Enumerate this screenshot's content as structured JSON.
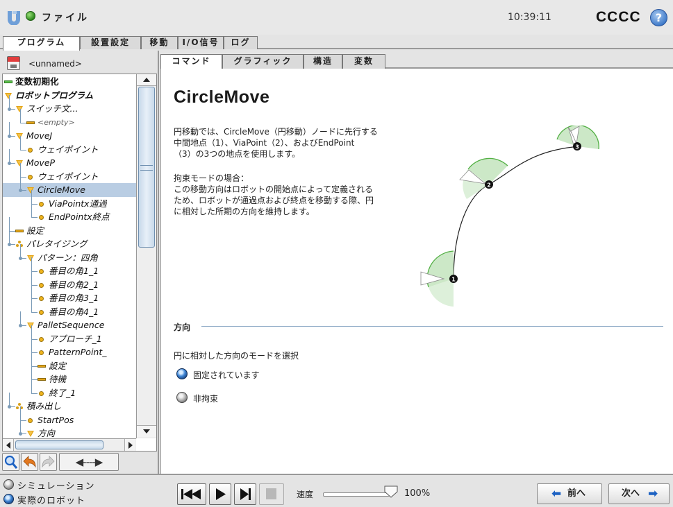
{
  "header": {
    "app_title": "ファイル",
    "clock": "10:39:11",
    "robot_name": "CCCC",
    "help_icon": "?"
  },
  "main_tabs": [
    "プログラム",
    "設置設定",
    "移動",
    "I/O信号",
    "ログ"
  ],
  "file": {
    "name": "<unnamed>"
  },
  "tree": [
    {
      "label": "変数初期化",
      "icon": "bar-green",
      "level": 0,
      "style": "bold"
    },
    {
      "label": "ロボットプログラム",
      "icon": "tri-orange",
      "level": 0,
      "style": "bold-italic"
    },
    {
      "label": "スイッチ文...",
      "icon": "tri",
      "level": 1,
      "style": "italic"
    },
    {
      "label": "<empty>",
      "icon": "bar",
      "level": 2,
      "style": "italic-gray"
    },
    {
      "label": "MoveJ",
      "icon": "tri",
      "level": 1,
      "style": "italic"
    },
    {
      "label": "ウェイポイント",
      "icon": "dot",
      "level": 2,
      "style": "italic"
    },
    {
      "label": "MoveP",
      "icon": "tri",
      "level": 1,
      "style": "italic"
    },
    {
      "label": "ウェイポイント",
      "icon": "dot",
      "level": 2,
      "style": "italic"
    },
    {
      "label": "CircleMove",
      "icon": "tri",
      "level": 2,
      "style": "italic",
      "selected": true
    },
    {
      "label": "ViaPointx通過",
      "icon": "dot",
      "level": 3,
      "style": "italic"
    },
    {
      "label": "EndPointx終点",
      "icon": "dot",
      "level": 3,
      "style": "italic"
    },
    {
      "label": "設定",
      "icon": "bar",
      "level": 1,
      "style": "italic"
    },
    {
      "label": "パレタイジング",
      "icon": "pallet",
      "level": 1,
      "style": "italic"
    },
    {
      "label": "パターン：四角",
      "icon": "tri",
      "level": 2,
      "style": "italic"
    },
    {
      "label": "番目の角1_1",
      "icon": "dot",
      "level": 3,
      "style": "italic"
    },
    {
      "label": "番目の角2_1",
      "icon": "dot",
      "level": 3,
      "style": "italic"
    },
    {
      "label": "番目の角3_1",
      "icon": "dot",
      "level": 3,
      "style": "italic"
    },
    {
      "label": "番目の角4_1",
      "icon": "dot",
      "level": 3,
      "style": "italic"
    },
    {
      "label": "PalletSequence",
      "icon": "tri",
      "level": 2,
      "style": "italic"
    },
    {
      "label": "アプローチ_1",
      "icon": "dot",
      "level": 3,
      "style": "italic"
    },
    {
      "label": "PatternPoint_",
      "icon": "dot",
      "level": 3,
      "style": "italic"
    },
    {
      "label": "設定",
      "icon": "bar",
      "level": 3,
      "style": "italic"
    },
    {
      "label": "待機",
      "icon": "bar",
      "level": 3,
      "style": "italic"
    },
    {
      "label": "終了_1",
      "icon": "dot",
      "level": 3,
      "style": "italic"
    },
    {
      "label": "積み出し",
      "icon": "pallet",
      "level": 1,
      "style": "italic"
    },
    {
      "label": "StartPos",
      "icon": "dot",
      "level": 2,
      "style": "italic"
    },
    {
      "label": "方向",
      "icon": "tri",
      "level": 2,
      "style": "italic"
    }
  ],
  "tree_tools": {
    "search_icon": "search-icon",
    "undo_icon": "undo-icon",
    "redo_icon": "redo-icon",
    "arrow_label": "◀----▶"
  },
  "sub_tabs": [
    "コマンド",
    "グラフィック",
    "構造",
    "変数"
  ],
  "command": {
    "title": "CircleMove",
    "description_1": "円移動では、CircleMove（円移動）ノードに先行する\n中間地点（1）、ViaPoint（2）、およびEndPoint\n（3）の3つの地点を使用します。",
    "description_2": "拘束モードの場合：\nこの移動方向はロボットの開始点によって定義される\nため、ロボットが通過点および終点を移動する際、円\nに相対した所期の方向を維持します。",
    "diagram_labels": [
      "1",
      "2",
      "3"
    ],
    "direction_title": "方向",
    "mode_prompt": "円に相対した方向のモードを選択",
    "options": [
      {
        "label": "固定されています",
        "selected": true
      },
      {
        "label": "非拘束",
        "selected": false
      }
    ]
  },
  "bottom": {
    "modes": [
      {
        "label": "シミュレーション",
        "selected": false
      },
      {
        "label": "実際のロボット",
        "selected": true
      }
    ],
    "speed_label": "速度",
    "speed_value": "100%",
    "speed_fraction": 1.0,
    "prev_label": "前へ",
    "next_label": "次へ"
  }
}
